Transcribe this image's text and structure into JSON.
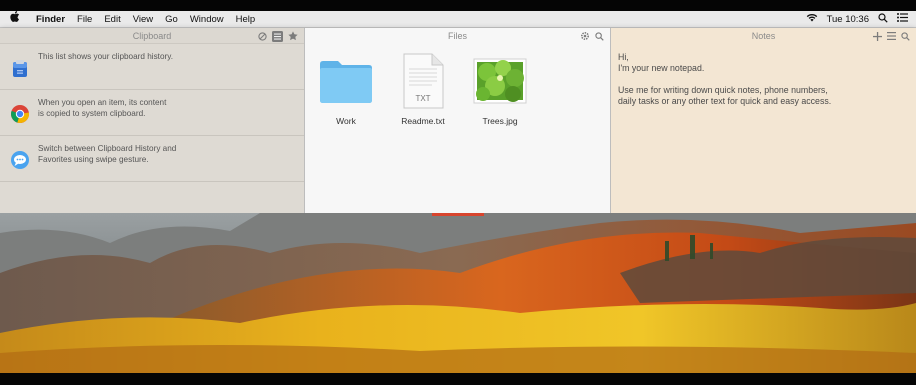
{
  "menubar": {
    "app_name": "Finder",
    "items": [
      "File",
      "Edit",
      "View",
      "Go",
      "Window",
      "Help"
    ],
    "clock": "Tue 10:36"
  },
  "clipboard": {
    "title": "Clipboard",
    "items": [
      {
        "icon": "clipboard-app-icon",
        "text": "This list shows your clipboard history."
      },
      {
        "icon": "chrome-icon",
        "text": "When you open an item, its content\nis copied to system clipboard."
      },
      {
        "icon": "messages-icon",
        "text": "Switch between Clipboard History and\nFavorites using swipe gesture."
      }
    ]
  },
  "files": {
    "title": "Files",
    "items": [
      {
        "icon": "folder-icon",
        "name": "Work"
      },
      {
        "icon": "text-file-icon",
        "name": "Readme.txt",
        "badge": "TXT"
      },
      {
        "icon": "image-file-icon",
        "name": "Trees.jpg"
      }
    ]
  },
  "notes": {
    "title": "Notes",
    "lines": [
      "Hi,",
      "I'm your new notepad.",
      "",
      "Use me for writing down quick notes, phone numbers,",
      "daily tasks or any other text for quick and easy access."
    ]
  },
  "colors": {
    "clipboard_bg": "#dedad3",
    "files_bg": "#f7f7f7",
    "notes_bg": "#f3e6d3",
    "folder_blue": "#6cc3f2"
  }
}
